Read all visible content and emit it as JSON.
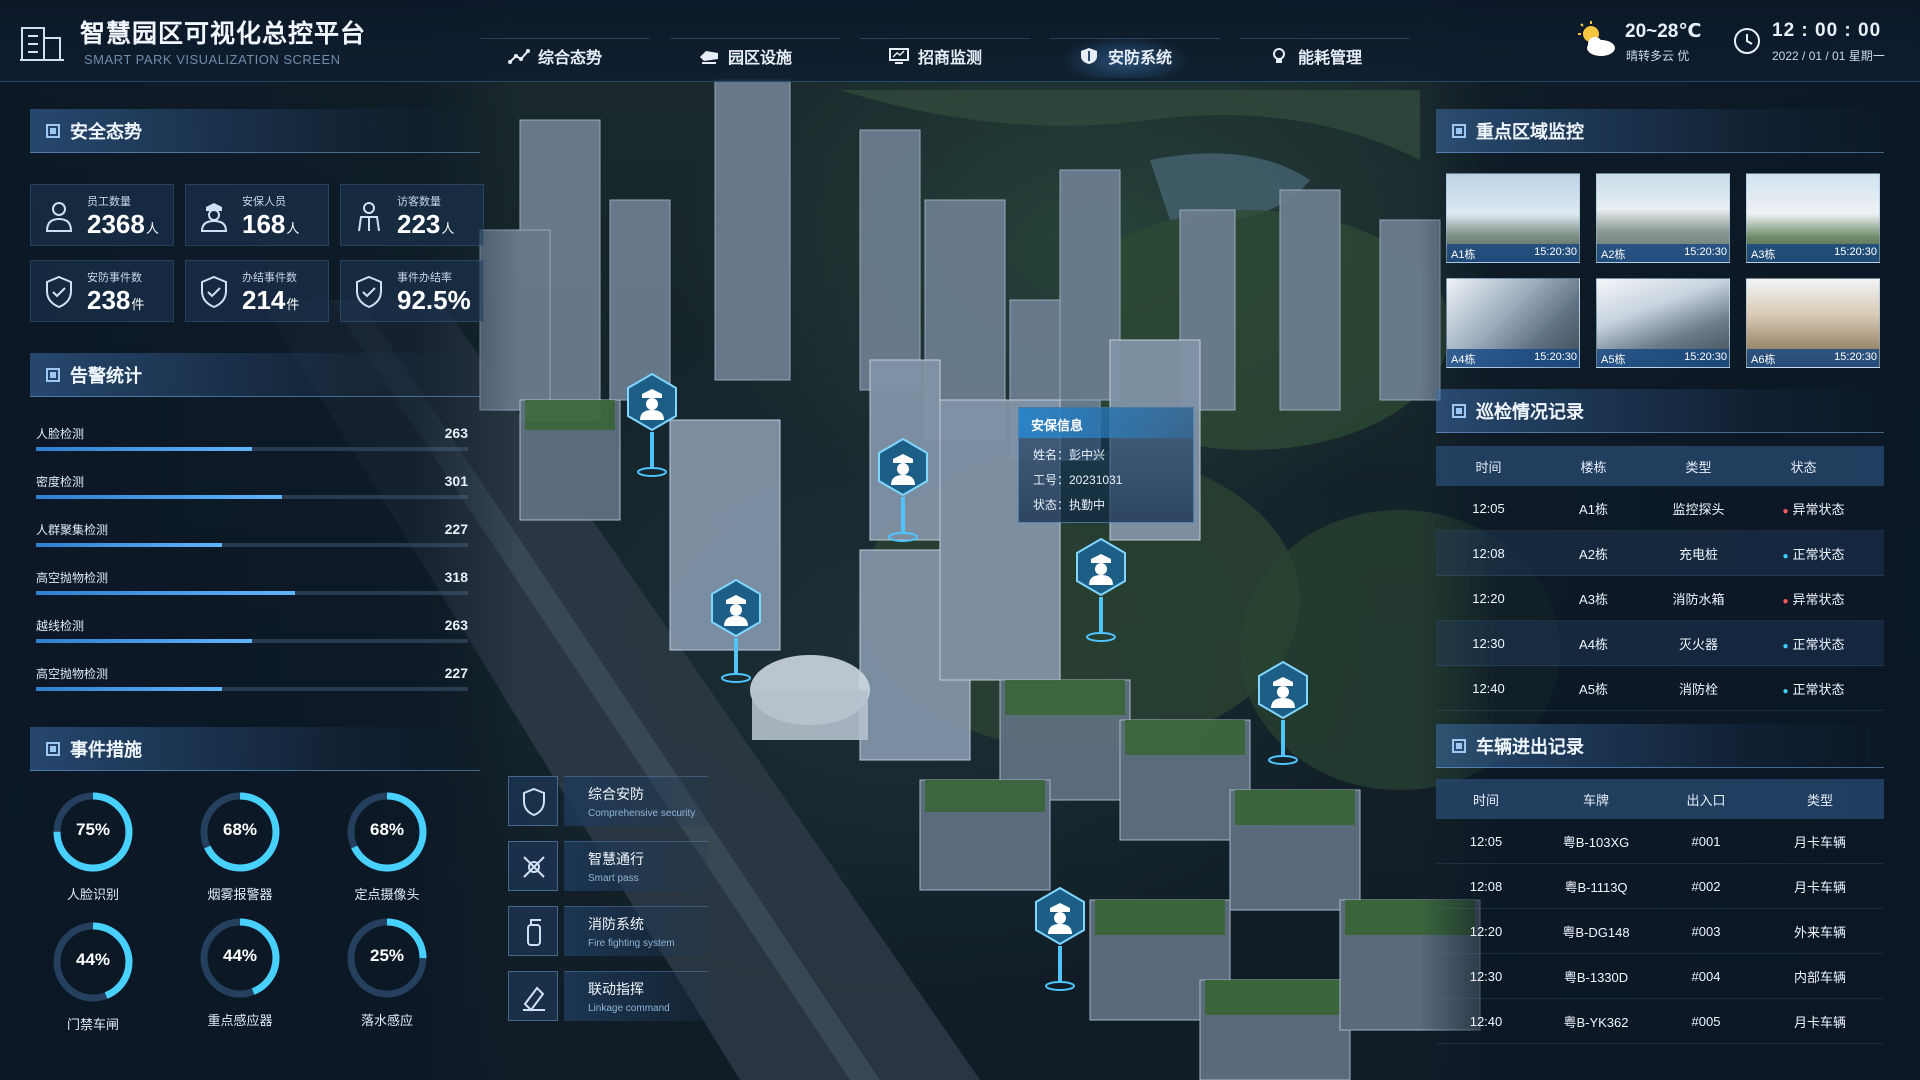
{
  "header": {
    "title": "智慧园区可视化总控平台",
    "subtitle": "SMART PARK VISUALIZATION SCREEN",
    "tabs": [
      {
        "label": "综合态势",
        "icon": "trend-icon"
      },
      {
        "label": "园区设施",
        "icon": "facility-icon"
      },
      {
        "label": "招商监测",
        "icon": "monitor-icon"
      },
      {
        "label": "安防系统",
        "icon": "shield-icon",
        "active": true
      },
      {
        "label": "能耗管理",
        "icon": "bulb-icon"
      }
    ],
    "weather": {
      "temp": "20~28℃",
      "desc": "晴转多云  优",
      "icon": "partly-cloudy-icon"
    },
    "clock": {
      "time": "12 : 00 : 00",
      "date": "2022 / 01 / 01  星期一"
    }
  },
  "safety": {
    "title": "安全态势",
    "stats": [
      {
        "label": "员工数量",
        "value": "2368",
        "unit": "人",
        "icon": "employee-icon"
      },
      {
        "label": "安保人员",
        "value": "168",
        "unit": "人",
        "icon": "guard-icon"
      },
      {
        "label": "访客数量",
        "value": "223",
        "unit": "人",
        "icon": "visitor-icon"
      },
      {
        "label": "安防事件数",
        "value": "238",
        "unit": "件",
        "icon": "shield-check-icon"
      },
      {
        "label": "办结事件数",
        "value": "214",
        "unit": "件",
        "icon": "shield-check-icon"
      },
      {
        "label": "事件办结率",
        "value": "92.5%",
        "unit": "",
        "icon": "shield-check-icon"
      }
    ]
  },
  "alarms": {
    "title": "告警统计",
    "items": [
      {
        "label": "人脸检测",
        "value": "263",
        "ratio": 0.5
      },
      {
        "label": "密度检测",
        "value": "301",
        "ratio": 0.57
      },
      {
        "label": "人群聚集检测",
        "value": "227",
        "ratio": 0.43
      },
      {
        "label": "高空抛物检测",
        "value": "318",
        "ratio": 0.6
      },
      {
        "label": "越线检测",
        "value": "263",
        "ratio": 0.5
      },
      {
        "label": "高空抛物检测",
        "value": "227",
        "ratio": 0.43
      }
    ]
  },
  "measures": {
    "title": "事件措施",
    "rings": [
      {
        "label": "人脸识别",
        "value": "75%",
        "pct": 75
      },
      {
        "label": "烟雾报警器",
        "value": "68%",
        "pct": 68
      },
      {
        "label": "定点摄像头",
        "value": "68%",
        "pct": 68
      },
      {
        "label": "门禁车闸",
        "value": "44%",
        "pct": 44
      },
      {
        "label": "重点感应器",
        "value": "44%",
        "pct": 44
      },
      {
        "label": "落水感应",
        "value": "25%",
        "pct": 25
      }
    ],
    "buttons": [
      {
        "cn": "综合安防",
        "en": "Comprehensive security",
        "icon": "shield-icon"
      },
      {
        "cn": "智慧通行",
        "en": "Smart pass",
        "icon": "pass-icon"
      },
      {
        "cn": "消防系统",
        "en": "Fire fighting system",
        "icon": "extinguisher-icon"
      },
      {
        "cn": "联动指挥",
        "en": "Linkage command",
        "icon": "command-icon"
      }
    ]
  },
  "cameras": {
    "title": "重点区域监控",
    "items": [
      {
        "name": "A1栋",
        "time": "15:20:30"
      },
      {
        "name": "A2栋",
        "time": "15:20:30"
      },
      {
        "name": "A3栋",
        "time": "15:20:30"
      },
      {
        "name": "A4栋",
        "time": "15:20:30"
      },
      {
        "name": "A5栋",
        "time": "15:20:30"
      },
      {
        "name": "A6栋",
        "time": "15:20:30"
      }
    ]
  },
  "patrol": {
    "title": "巡检情况记录",
    "columns": [
      "时间",
      "楼栋",
      "类型",
      "状态"
    ],
    "rows": [
      [
        "12:05",
        "A1栋",
        "监控探头",
        "异常状态"
      ],
      [
        "12:08",
        "A2栋",
        "充电桩",
        "正常状态"
      ],
      [
        "12:20",
        "A3栋",
        "消防水箱",
        "异常状态"
      ],
      [
        "12:30",
        "A4栋",
        "灭火器",
        "正常状态"
      ],
      [
        "12:40",
        "A5栋",
        "消防栓",
        "正常状态"
      ]
    ]
  },
  "vehicles": {
    "title": "车辆进出记录",
    "columns": [
      "时间",
      "车牌",
      "出入口",
      "类型"
    ],
    "rows": [
      [
        "12:05",
        "粤B-103XG",
        "#001",
        "月卡车辆"
      ],
      [
        "12:08",
        "粤B-1113Q",
        "#002",
        "月卡车辆"
      ],
      [
        "12:20",
        "粤B-DG148",
        "#003",
        "外来车辆"
      ],
      [
        "12:30",
        "粤B-1330D",
        "#004",
        "内部车辆"
      ],
      [
        "12:40",
        "粤B-YK362",
        "#005",
        "月卡车辆"
      ]
    ]
  },
  "popup": {
    "title": "安保信息",
    "name": "姓名：彭中兴",
    "id": "工号：20231031",
    "status": "状态：执勤中"
  },
  "colors": {
    "accent": "#5fb6ff",
    "ring": "#48d0ff",
    "alert": "#ff5c5c",
    "normal": "#3fd0ff"
  }
}
